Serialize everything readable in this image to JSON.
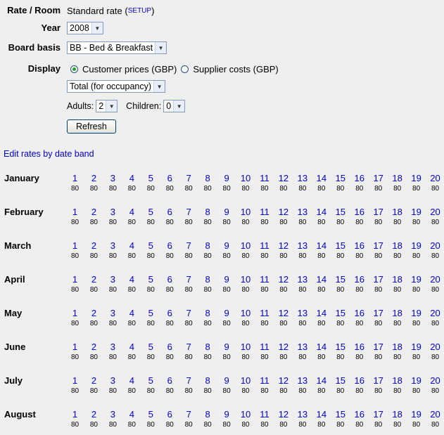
{
  "form": {
    "rate_label": "Rate / Room",
    "rate_value": "Standard rate",
    "setup_link": "SETUP",
    "year_label": "Year",
    "year_value": "2008",
    "board_label": "Board basis",
    "board_value": "BB - Bed & Breakfast",
    "display_label": "Display",
    "display_options": [
      "Customer prices (GBP)",
      "Supplier costs (GBP)"
    ],
    "display_selected": 0,
    "total_value": "Total (for occupancy)",
    "adults_label": "Adults:",
    "adults_value": "2",
    "children_label": "Children:",
    "children_value": "0",
    "refresh_label": "Refresh"
  },
  "edit_link": "Edit rates by date band",
  "days": [
    "1",
    "2",
    "3",
    "4",
    "5",
    "6",
    "7",
    "8",
    "9",
    "10",
    "11",
    "12",
    "13",
    "14",
    "15",
    "16",
    "17",
    "18",
    "19",
    "20"
  ],
  "months": [
    {
      "name": "January",
      "prices": [
        "80",
        "80",
        "80",
        "80",
        "80",
        "80",
        "80",
        "80",
        "80",
        "80",
        "80",
        "80",
        "80",
        "80",
        "80",
        "80",
        "80",
        "80",
        "80",
        "80"
      ]
    },
    {
      "name": "February",
      "prices": [
        "80",
        "80",
        "80",
        "80",
        "80",
        "80",
        "80",
        "80",
        "80",
        "80",
        "80",
        "80",
        "80",
        "80",
        "80",
        "80",
        "80",
        "80",
        "80",
        "80"
      ]
    },
    {
      "name": "March",
      "prices": [
        "80",
        "80",
        "80",
        "80",
        "80",
        "80",
        "80",
        "80",
        "80",
        "80",
        "80",
        "80",
        "80",
        "80",
        "80",
        "80",
        "80",
        "80",
        "80",
        "80"
      ]
    },
    {
      "name": "April",
      "prices": [
        "80",
        "80",
        "80",
        "80",
        "80",
        "80",
        "80",
        "80",
        "80",
        "80",
        "80",
        "80",
        "80",
        "80",
        "80",
        "80",
        "80",
        "80",
        "80",
        "80"
      ]
    },
    {
      "name": "May",
      "prices": [
        "80",
        "80",
        "80",
        "80",
        "80",
        "80",
        "80",
        "80",
        "80",
        "80",
        "80",
        "80",
        "80",
        "80",
        "80",
        "80",
        "80",
        "80",
        "80",
        "80"
      ]
    },
    {
      "name": "June",
      "prices": [
        "80",
        "80",
        "80",
        "80",
        "80",
        "80",
        "80",
        "80",
        "80",
        "80",
        "80",
        "80",
        "80",
        "80",
        "80",
        "80",
        "80",
        "80",
        "80",
        "80"
      ]
    },
    {
      "name": "July",
      "prices": [
        "80",
        "80",
        "80",
        "80",
        "80",
        "80",
        "80",
        "80",
        "80",
        "80",
        "80",
        "80",
        "80",
        "80",
        "80",
        "80",
        "80",
        "80",
        "80",
        "80"
      ]
    },
    {
      "name": "August",
      "prices": [
        "80",
        "80",
        "80",
        "80",
        "80",
        "80",
        "80",
        "80",
        "80",
        "80",
        "80",
        "80",
        "80",
        "80",
        "80",
        "80",
        "80",
        "80",
        "80",
        "80"
      ]
    }
  ],
  "icons": {
    "dropdown_arrow": "chevron-down-icon",
    "radio": "radio-button"
  }
}
